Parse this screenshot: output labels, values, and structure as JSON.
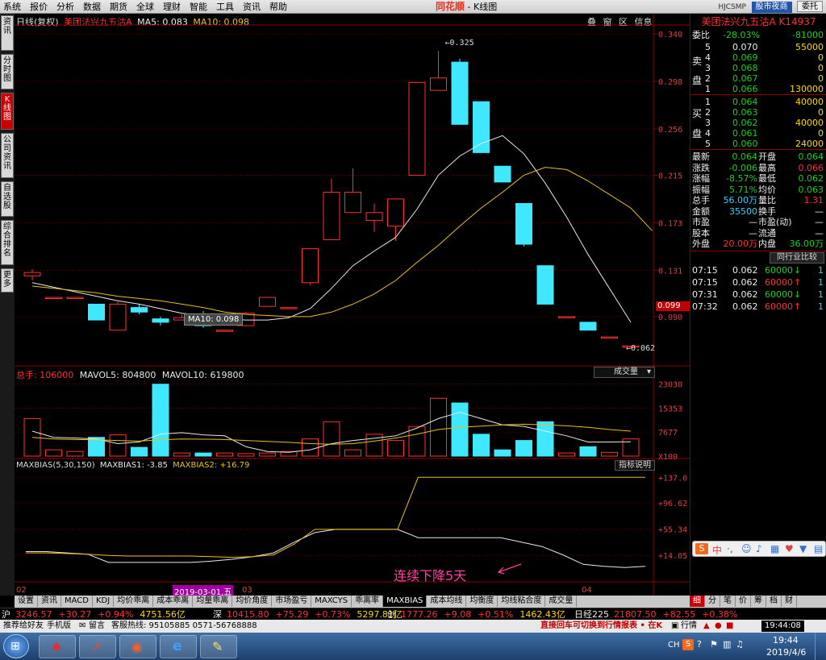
{
  "menu": [
    "系统",
    "报价",
    "分析",
    "数据",
    "期货",
    "全球",
    "理财",
    "智能",
    "工具",
    "资讯",
    "帮助"
  ],
  "center_logo": "同花顺",
  "center_title": "- K线图",
  "user_id": "HJCSMP",
  "top_buttons": [
    "股市夜商",
    "委托"
  ],
  "left_nav": [
    "资讯",
    "分时图",
    "K线图",
    "公司资讯",
    "自选股",
    "综合排名",
    "更多"
  ],
  "chart_header": {
    "period": "日线(复权)",
    "stock": "美团法兴九五沽A",
    "ma5": "MA5: 0.083",
    "ma10": "MA10: 0.098",
    "icons": [
      "叠",
      "窗",
      "区",
      "信息"
    ]
  },
  "colors": {
    "up": "#ff3030",
    "down": "#40e8ff",
    "ma5": "#e8e8e8",
    "ma10": "#e8c020",
    "grid": "#8a0000"
  },
  "chart_data": [
    {
      "type": "candlestick",
      "name": "price",
      "ylim": [
        0.05,
        0.345
      ],
      "yticks": [
        "0.340",
        "0.298",
        "0.256",
        "0.215",
        "0.173",
        "0.131",
        "0.090"
      ],
      "current_price_label": "0.099",
      "annotations": [
        "0.325",
        "0.062"
      ],
      "tooltip": "MA10: 0.098",
      "candles": [
        {
          "o": 0.126,
          "c": 0.129,
          "h": 0.132,
          "l": 0.122
        },
        {
          "o": 0.107,
          "c": 0.107,
          "h": 0.107,
          "l": 0.107
        },
        {
          "o": 0.107,
          "c": 0.107,
          "h": 0.107,
          "l": 0.107
        },
        {
          "o": 0.101,
          "c": 0.087,
          "h": 0.101,
          "l": 0.087
        },
        {
          "o": 0.078,
          "c": 0.101,
          "h": 0.103,
          "l": 0.078
        },
        {
          "o": 0.098,
          "c": 0.094,
          "h": 0.101,
          "l": 0.092
        },
        {
          "o": 0.088,
          "c": 0.085,
          "h": 0.09,
          "l": 0.082
        },
        {
          "o": 0.087,
          "c": 0.089,
          "h": 0.092,
          "l": 0.087
        },
        {
          "o": 0.089,
          "c": 0.082,
          "h": 0.095,
          "l": 0.08
        },
        {
          "o": 0.078,
          "c": 0.078,
          "h": 0.078,
          "l": 0.078
        },
        {
          "o": 0.082,
          "c": 0.093,
          "h": 0.094,
          "l": 0.082
        },
        {
          "o": 0.099,
          "c": 0.107,
          "h": 0.107,
          "l": 0.099
        },
        {
          "o": 0.098,
          "c": 0.098,
          "h": 0.098,
          "l": 0.098
        },
        {
          "o": 0.12,
          "c": 0.15,
          "h": 0.15,
          "l": 0.118
        },
        {
          "o": 0.158,
          "c": 0.2,
          "h": 0.212,
          "l": 0.158
        },
        {
          "o": 0.182,
          "c": 0.2,
          "h": 0.221,
          "l": 0.182
        },
        {
          "o": 0.175,
          "c": 0.182,
          "h": 0.19,
          "l": 0.165
        },
        {
          "o": 0.17,
          "c": 0.194,
          "h": 0.194,
          "l": 0.157
        },
        {
          "o": 0.215,
          "c": 0.297,
          "h": 0.297,
          "l": 0.215
        },
        {
          "o": 0.29,
          "c": 0.301,
          "h": 0.325,
          "l": 0.29
        },
        {
          "o": 0.315,
          "c": 0.26,
          "h": 0.318,
          "l": 0.26
        },
        {
          "o": 0.28,
          "c": 0.235,
          "h": 0.28,
          "l": 0.235
        },
        {
          "o": 0.223,
          "c": 0.209,
          "h": 0.223,
          "l": 0.209
        },
        {
          "o": 0.19,
          "c": 0.154,
          "h": 0.19,
          "l": 0.152
        },
        {
          "o": 0.135,
          "c": 0.101,
          "h": 0.135,
          "l": 0.101
        },
        {
          "o": 0.09,
          "c": 0.09,
          "h": 0.09,
          "l": 0.09
        },
        {
          "o": 0.085,
          "c": 0.078,
          "h": 0.085,
          "l": 0.078
        },
        {
          "o": 0.072,
          "c": 0.072,
          "h": 0.072,
          "l": 0.072
        },
        {
          "o": 0.064,
          "c": 0.064,
          "h": 0.064,
          "l": 0.062
        }
      ],
      "ma5": [
        0.12,
        0.116,
        0.112,
        0.108,
        0.104,
        0.101,
        0.097,
        0.093,
        0.091,
        0.088,
        0.087,
        0.087,
        0.089,
        0.097,
        0.115,
        0.135,
        0.148,
        0.16,
        0.185,
        0.215,
        0.232,
        0.243,
        0.25,
        0.234,
        0.208,
        0.178,
        0.145,
        0.115,
        0.085
      ],
      "ma10": [
        0.117,
        0.115,
        0.113,
        0.111,
        0.108,
        0.106,
        0.104,
        0.101,
        0.098,
        0.094,
        0.092,
        0.091,
        0.09,
        0.09,
        0.094,
        0.101,
        0.11,
        0.122,
        0.138,
        0.153,
        0.17,
        0.186,
        0.2,
        0.215,
        0.222,
        0.22,
        0.21,
        0.198,
        0.186,
        0.166
      ]
    },
    {
      "type": "bar",
      "name": "volume",
      "header": {
        "total": "总手: 106000",
        "mavol5": "MAVOL5: 804800",
        "mavol10": "MAVOL10: 619800",
        "selector": "成交量"
      },
      "yticks": [
        "23030",
        "15353",
        "7677",
        "X100"
      ],
      "ylim": [
        0,
        25000
      ],
      "values": [
        12000,
        2000,
        1500,
        6000,
        6800,
        2800,
        23000,
        1000,
        1000,
        1000,
        800,
        1000,
        1500,
        5500,
        11000,
        2000,
        7000,
        5000,
        9500,
        18500,
        17000,
        7000,
        2000,
        5000,
        11000,
        1000,
        3000,
        1200,
        5500
      ],
      "mavol5": [
        8000,
        6000,
        5800,
        5500,
        4000,
        4500,
        7000,
        7500,
        6800,
        6500,
        3000,
        1500,
        1200,
        2000,
        4000,
        5000,
        5700,
        6500,
        9000,
        12000,
        14000,
        12000,
        10000,
        9500,
        8000,
        6500,
        4500,
        4500,
        4600
      ],
      "mavol10": [
        6000,
        5500,
        5300,
        5200,
        5000,
        4800,
        5200,
        5500,
        5400,
        5300,
        5000,
        4700,
        4400,
        4000,
        3800,
        4000,
        4800,
        5800,
        7000,
        8500,
        9200,
        9600,
        10000,
        10200,
        10000,
        9700,
        9200,
        8500,
        8000
      ]
    },
    {
      "type": "line",
      "name": "MAXBIAS",
      "header": {
        "title": "MAXBIAS(5,30,150)",
        "b1": "MAXBIAS1: -3.85",
        "b2": "MAXBIAS2: +16.79",
        "help": "指标说明"
      },
      "yticks": [
        "+137.0",
        "+96.62",
        "+55.34",
        "+14.05"
      ],
      "ylim": [
        -25,
        150
      ],
      "maxbias1": [
        20,
        20,
        18,
        16,
        3,
        3,
        3,
        3,
        3,
        5,
        8,
        12,
        18,
        35,
        50,
        55,
        55,
        55,
        55,
        42,
        42,
        42,
        42,
        42,
        35,
        28,
        15,
        0,
        -3,
        -5,
        -3
      ],
      "maxbias2": [
        18,
        18,
        17,
        16,
        14,
        13,
        13,
        13,
        13,
        12,
        11,
        12,
        15,
        32,
        55,
        55,
        55,
        55,
        55,
        137,
        137,
        137,
        137,
        137,
        137,
        137,
        137,
        137,
        137,
        137,
        137
      ],
      "annotation": "连续下降5天"
    }
  ],
  "xlabels": [
    "02",
    "2019-03-01,五",
    "03",
    "04"
  ],
  "quote": {
    "title": "美团法兴九五沽A K14937",
    "weibi_label": "委比",
    "weibi": "-28.03%",
    "weicha": "-81000",
    "sell": [
      {
        "n": "5",
        "p": "0.070",
        "v": "55000"
      },
      {
        "n": "4",
        "p": "0.069",
        "v": "0"
      },
      {
        "n": "3",
        "p": "0.068",
        "v": "0"
      },
      {
        "n": "2",
        "p": "0.067",
        "v": "0"
      },
      {
        "n": "1",
        "p": "0.066",
        "v": "130000"
      }
    ],
    "buy": [
      {
        "n": "1",
        "p": "0.064",
        "v": "40000"
      },
      {
        "n": "2",
        "p": "0.063",
        "v": "0"
      },
      {
        "n": "3",
        "p": "0.062",
        "v": "40000"
      },
      {
        "n": "4",
        "p": "0.061",
        "v": "0"
      },
      {
        "n": "5",
        "p": "0.060",
        "v": "24000"
      }
    ],
    "sell_labels": [
      "卖",
      "盘"
    ],
    "buy_labels": [
      "买",
      "盘"
    ],
    "stats": [
      {
        "l1": "最新",
        "v1": "0.064",
        "l2": "开盘",
        "v2": "0.064"
      },
      {
        "l1": "涨跌",
        "v1": "-0.006",
        "l2": "最高",
        "v2": "0.066"
      },
      {
        "l1": "涨幅",
        "v1": "-8.57%",
        "l2": "最低",
        "v2": "0.062"
      },
      {
        "l1": "振幅",
        "v1": "5.71%",
        "l2": "均价",
        "v2": "0.063"
      },
      {
        "l1": "总手",
        "v1": "56.00万",
        "l2": "量比",
        "v2": "1.31"
      },
      {
        "l1": "金额",
        "v1": "35500",
        "l2": "换手",
        "v2": "—"
      },
      {
        "l1": "市盈",
        "v1": "—",
        "l2": "市盈(动)",
        "v2": "—"
      },
      {
        "l1": "股本",
        "v1": "—",
        "l2": "流通",
        "v2": "—"
      },
      {
        "l1": "外盘",
        "v1": "20.00万",
        "l2": "内盘",
        "v2": "36.00万"
      }
    ],
    "compare_btn": "同行业比较",
    "ticks": [
      {
        "t": "07:15",
        "p": "0.062",
        "v": "60000",
        "dir": "down",
        "n": "1"
      },
      {
        "t": "07:15",
        "p": "0.062",
        "v": "60000",
        "dir": "up",
        "n": "1"
      },
      {
        "t": "07:31",
        "p": "0.062",
        "v": "60000",
        "dir": "down",
        "n": "1"
      },
      {
        "t": "07:32",
        "p": "0.062",
        "v": "60000",
        "dir": "up",
        "n": "1"
      }
    ]
  },
  "bottom_tabs": [
    "设置",
    "资讯",
    "MACD",
    "KDJ",
    "均价乖离",
    "成本乖离",
    "均量乖离",
    "均价角度",
    "市场盈亏",
    "MAXCYS",
    "乖离率",
    "MAXBIAS",
    "成本均线",
    "均衡度",
    "均线粘合度",
    "成交量"
  ],
  "active_tab": "MAXBIAS",
  "right_tabs": [
    "细",
    "分",
    "笔",
    "价",
    "筹",
    "档",
    "财"
  ],
  "index_bar": [
    {
      "k": "沪",
      "v": "3246.57",
      "c": "+30.27",
      "p": "+0.94%",
      "a": "4751.56亿"
    },
    {
      "k": "深",
      "v": "10415.80",
      "c": "+75.29",
      "p": "+0.73%",
      "a": "5297.81亿"
    },
    {
      "k": "创",
      "v": "1777.26",
      "c": "+9.08",
      "p": "+0.51%",
      "a": "1462.43亿"
    },
    {
      "k": "日经225",
      "v": "21807.50",
      "c": "+82.55",
      "p": "+0.38%",
      "a": ""
    }
  ],
  "status": {
    "left": "推荐给好友",
    "phone": "手机版",
    "msg": "留言",
    "hotline": "客服热线: 95105885  0571-56768888",
    "ticker": "直接回车可切换到行情报表 • 在K",
    "hq": "行情",
    "time": "19:44:08"
  },
  "taskbar": {
    "clock": "19:44",
    "date": "2019/4/6",
    "lang": "CH"
  }
}
